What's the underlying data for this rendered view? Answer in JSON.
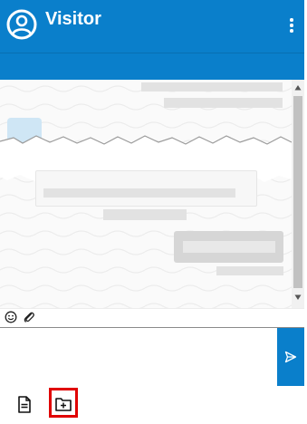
{
  "header": {
    "title": "Visitor",
    "avatar_icon": "user-circle-icon",
    "menu_icon": "kebab-menu-icon",
    "background": "#0a7fcb"
  },
  "chat": {
    "scroll_icon_up": "triangle-up-icon",
    "scroll_icon_down": "triangle-down-icon"
  },
  "toolbar": {
    "emoji_icon": "emoji-icon",
    "attach_icon": "paperclip-icon"
  },
  "composer": {
    "value": "",
    "placeholder": "",
    "send_icon": "send-icon"
  },
  "bottombar": {
    "items": [
      {
        "icon": "document-icon"
      },
      {
        "icon": "folder-plus-icon",
        "highlighted": true
      }
    ],
    "highlight_color": "#e00000"
  }
}
